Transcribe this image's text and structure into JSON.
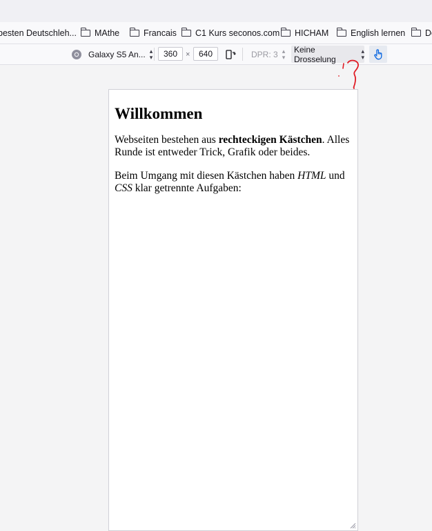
{
  "bookmarks": [
    {
      "label": "besten Deutschleh..."
    },
    {
      "label": "MAthe"
    },
    {
      "label": "Francais"
    },
    {
      "label": "C1 Kurs seconos.com"
    },
    {
      "label": "HICHAM"
    },
    {
      "label": "English lernen"
    },
    {
      "label": "De"
    }
  ],
  "devtools": {
    "device": "Galaxy S5 An...",
    "width": "360",
    "times": "×",
    "height": "640",
    "dpr": "DPR: 3",
    "throttling": "Keine Drosselung"
  },
  "page": {
    "heading": "Willkommen",
    "p1_a": "Webseiten bestehen aus ",
    "p1_bold": "rechteckigen Kästchen",
    "p1_b": ". Alles Runde ist entweder Trick, Grafik oder beides.",
    "p2_a": "Beim Umgang mit diesen Kästchen haben ",
    "p2_em1": "HTML",
    "p2_b": " und ",
    "p2_em2": "CSS",
    "p2_c": " klar getrennte Aufgaben:"
  },
  "annotation": {
    "color": "#e01b24"
  }
}
